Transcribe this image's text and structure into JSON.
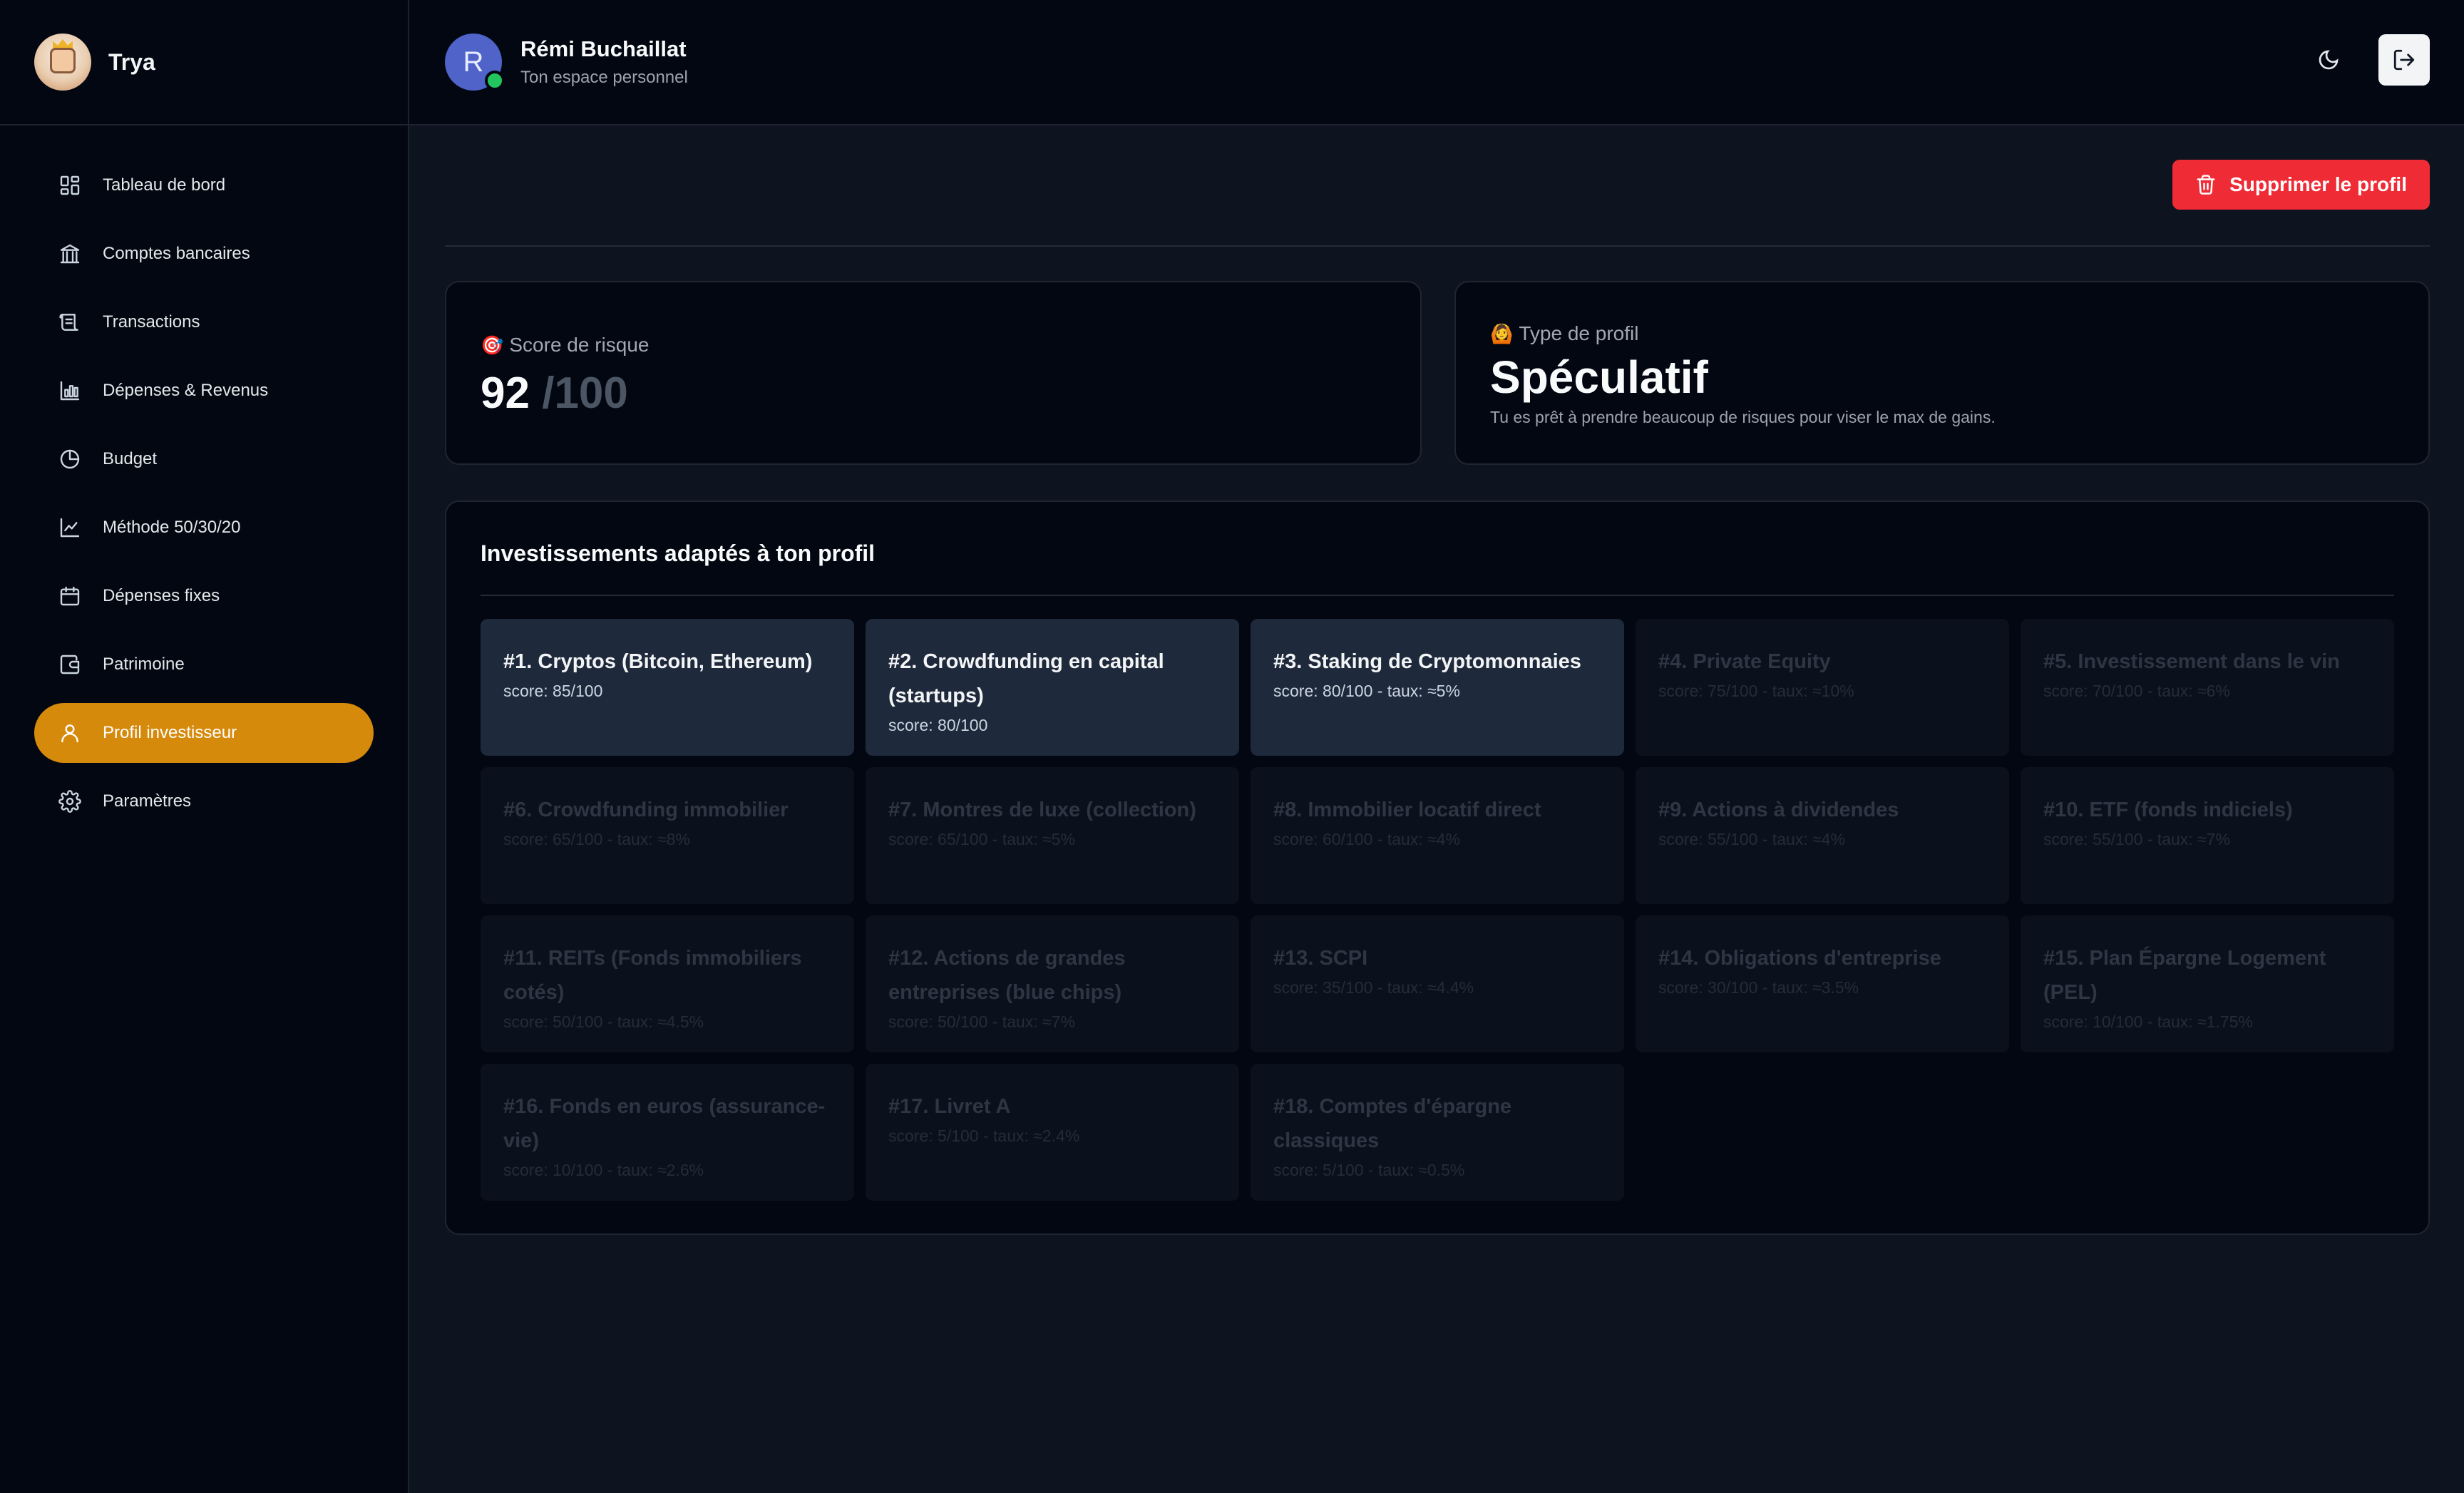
{
  "app": {
    "name": "Trya"
  },
  "sidebar": {
    "items": [
      {
        "label": "Tableau de bord",
        "icon": "dashboard-icon"
      },
      {
        "label": "Comptes bancaires",
        "icon": "bank-icon"
      },
      {
        "label": "Transactions",
        "icon": "receipt-icon"
      },
      {
        "label": "Dépenses & Revenus",
        "icon": "bar-chart-icon"
      },
      {
        "label": "Budget",
        "icon": "pie-chart-icon"
      },
      {
        "label": "Méthode 50/30/20",
        "icon": "line-chart-icon"
      },
      {
        "label": "Dépenses fixes",
        "icon": "calendar-icon"
      },
      {
        "label": "Patrimoine",
        "icon": "wallet-icon"
      },
      {
        "label": "Profil investisseur",
        "icon": "user-icon",
        "active": true
      },
      {
        "label": "Paramètres",
        "icon": "gear-icon"
      }
    ]
  },
  "header": {
    "avatar_initial": "R",
    "user_name": "Rémi Buchaillat",
    "user_subtitle": "Ton espace personnel"
  },
  "main": {
    "delete_button": "Supprimer le profil",
    "score": {
      "emoji": "🎯",
      "label": "Score de risque",
      "value": "92",
      "max": "/100"
    },
    "profile": {
      "emoji": "🙆",
      "label": "Type de profil",
      "type": "Spéculatif",
      "description": "Tu es prêt à prendre beaucoup de risques pour viser le max de gains."
    },
    "investments": {
      "title": "Investissements adaptés à ton profil",
      "items": [
        {
          "name": "#1. Cryptos (Bitcoin, Ethereum)",
          "meta": "score: 85/100",
          "active": true
        },
        {
          "name": "#2. Crowdfunding en capital (startups)",
          "meta": "score: 80/100",
          "active": true
        },
        {
          "name": "#3. Staking de Cryptomonnaies",
          "meta": "score: 80/100 - taux: ≈5%",
          "active": true
        },
        {
          "name": "#4. Private Equity",
          "meta": "score: 75/100 - taux: ≈10%",
          "active": false
        },
        {
          "name": "#5. Investissement dans le vin",
          "meta": "score: 70/100 - taux: ≈6%",
          "active": false
        },
        {
          "name": "#6. Crowdfunding immobilier",
          "meta": "score: 65/100 - taux: ≈8%",
          "active": false
        },
        {
          "name": "#7. Montres de luxe (collection)",
          "meta": "score: 65/100 - taux: ≈5%",
          "active": false
        },
        {
          "name": "#8. Immobilier locatif direct",
          "meta": "score: 60/100 - taux: ≈4%",
          "active": false
        },
        {
          "name": "#9. Actions à dividendes",
          "meta": "score: 55/100 - taux: ≈4%",
          "active": false
        },
        {
          "name": "#10. ETF (fonds indiciels)",
          "meta": "score: 55/100 - taux: ≈7%",
          "active": false
        },
        {
          "name": "#11. REITs (Fonds immobiliers cotés)",
          "meta": "score: 50/100 - taux: ≈4.5%",
          "active": false
        },
        {
          "name": "#12. Actions de grandes entreprises (blue chips)",
          "meta": "score: 50/100 - taux: ≈7%",
          "active": false
        },
        {
          "name": "#13. SCPI",
          "meta": "score: 35/100 - taux: ≈4.4%",
          "active": false
        },
        {
          "name": "#14. Obligations d'entreprise",
          "meta": "score: 30/100 - taux: ≈3.5%",
          "active": false
        },
        {
          "name": "#15. Plan Épargne Logement (PEL)",
          "meta": "score: 10/100 - taux: ≈1.75%",
          "active": false
        },
        {
          "name": "#16. Fonds en euros (assurance-vie)",
          "meta": "score: 10/100 - taux: ≈2.6%",
          "active": false
        },
        {
          "name": "#17. Livret A",
          "meta": "score: 5/100 - taux: ≈2.4%",
          "active": false
        },
        {
          "name": "#18. Comptes d'épargne classiques",
          "meta": "score: 5/100 - taux: ≈0.5%",
          "active": false
        }
      ]
    }
  },
  "colors": {
    "accent": "#d68a0c",
    "danger": "#ef2b35",
    "online": "#22c55e",
    "avatar": "#4f63c9"
  }
}
